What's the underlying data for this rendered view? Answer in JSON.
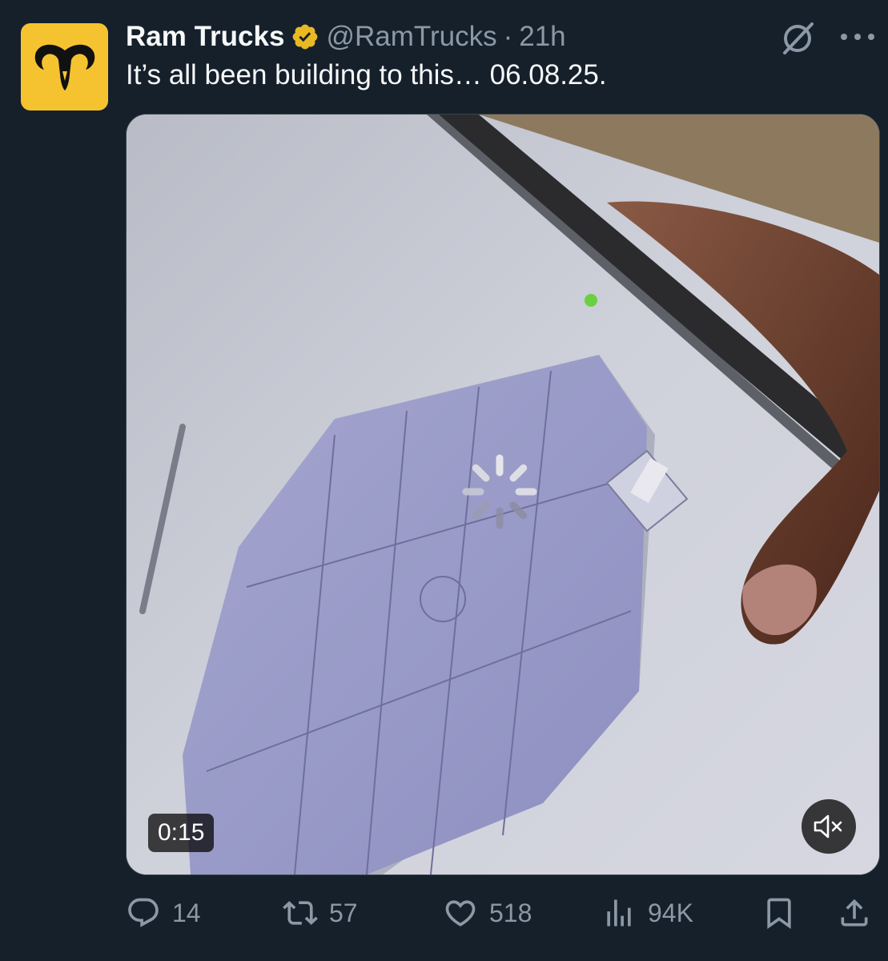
{
  "author": {
    "display_name": "Ram Trucks",
    "handle": "@RamTrucks",
    "separator": "·",
    "time": "21h",
    "verified_badge_color": "#e8b923",
    "avatar_bg": "#f6c330"
  },
  "tweet": {
    "text": "It’s all been building to this… 06.08.25."
  },
  "media": {
    "type": "video",
    "duration": "0:15",
    "state": "loading",
    "muted": true
  },
  "actions": {
    "replies": "14",
    "reposts": "57",
    "likes": "518",
    "views": "94K"
  },
  "icons": {
    "grok": "grok-icon",
    "more": "more-icon",
    "reply": "reply-icon",
    "repost": "repost-icon",
    "like": "like-icon",
    "views": "views-icon",
    "bookmark": "bookmark-icon",
    "share": "share-icon",
    "mute": "mute-icon"
  },
  "colors": {
    "background": "#15202b",
    "text": "#f7f9f9",
    "muted_text": "#8b98a5"
  }
}
